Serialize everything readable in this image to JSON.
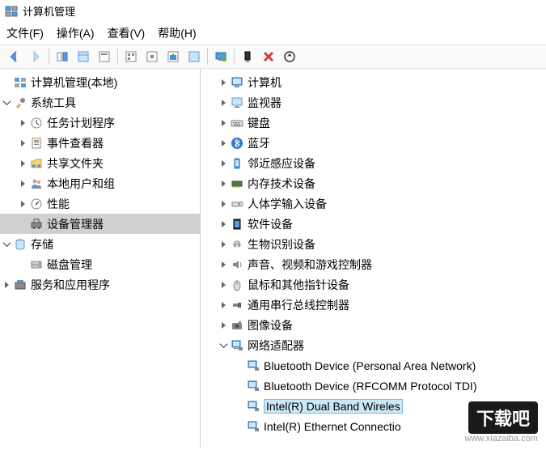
{
  "window": {
    "title": "计算机管理"
  },
  "menu": {
    "file": "文件(F)",
    "action": "操作(A)",
    "view": "查看(V)",
    "help": "帮助(H)"
  },
  "leftTree": {
    "root": "计算机管理(本地)",
    "systemTools": "系统工具",
    "taskScheduler": "任务计划程序",
    "eventViewer": "事件查看器",
    "sharedFolders": "共享文件夹",
    "localUsers": "本地用户和组",
    "performance": "性能",
    "deviceManager": "设备管理器",
    "storage": "存储",
    "diskManagement": "磁盘管理",
    "services": "服务和应用程序"
  },
  "rightTree": {
    "computer": "计算机",
    "monitor": "监视器",
    "keyboard": "键盘",
    "bluetooth": "蓝牙",
    "proximity": "邻近感应设备",
    "memory": "内存技术设备",
    "hid": "人体学输入设备",
    "software": "软件设备",
    "biometric": "生物识别设备",
    "sound": "声音、视频和游戏控制器",
    "mouse": "鼠标和其他指针设备",
    "usb": "通用串行总线控制器",
    "imaging": "图像设备",
    "network": "网络适配器",
    "netDev1": "Bluetooth Device (Personal Area Network)",
    "netDev2": "Bluetooth Device (RFCOMM Protocol TDI)",
    "netDev3": "Intel(R) Dual Band Wireles",
    "netDev4": "Intel(R) Ethernet Connectio"
  },
  "watermark": {
    "text": "下载吧",
    "url": "www.xiazaiba.com"
  }
}
